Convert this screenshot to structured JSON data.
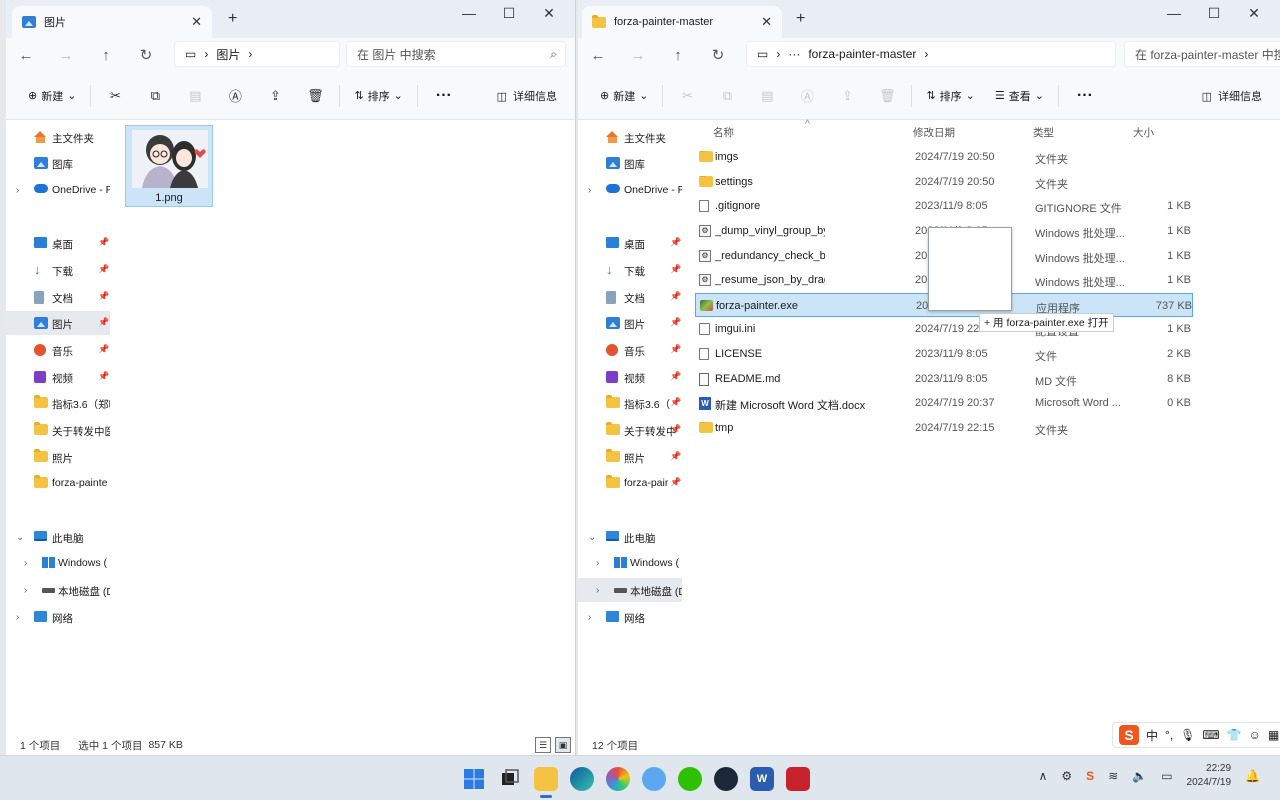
{
  "left_window": {
    "tab_title": "图片",
    "tab_close": "✕",
    "new_tab": "+",
    "win_btns": [
      "—",
      "☐",
      "✕"
    ],
    "address_folder": "图片",
    "address_sep": "›",
    "search_placeholder": "在 图片 中搜索",
    "toolbar": {
      "new_label": "新建",
      "sort_label": "排序",
      "details_label": "详细信息"
    },
    "sidebar": {
      "home": "主文件夹",
      "gallery": "图库",
      "onedrive": "OneDrive - P",
      "desktop": "桌面",
      "downloads": "下载",
      "documents": "文档",
      "pictures": "图片",
      "music": "音乐",
      "videos": "视频",
      "folder1": "指标3.6（郑噼",
      "folder2": "关于转发中医",
      "folder3": "照片",
      "folder4": "forza-painte",
      "this_pc": "此电脑",
      "windows_drive": "Windows (",
      "local_disk": "本地磁盘 (D",
      "network": "网络"
    },
    "files": [
      {
        "name": "1.png"
      }
    ],
    "status": {
      "count": "1 个项目",
      "selected": "选中 1 个项目",
      "size": "857 KB"
    }
  },
  "right_window": {
    "tab_title": "forza-painter-master",
    "tab_close": "✕",
    "new_tab": "+",
    "win_btns": [
      "—",
      "☐",
      "✕"
    ],
    "address_more": "···",
    "address_folder": "forza-painter-master",
    "address_sep": "›",
    "search_placeholder": "在 forza-painter-master 中搜",
    "toolbar": {
      "new_label": "新建",
      "sort_label": "排序",
      "view_label": "查看",
      "details_label": "详细信息"
    },
    "sidebar": {
      "home": "主文件夹",
      "gallery": "图库",
      "onedrive": "OneDrive - P",
      "desktop": "桌面",
      "downloads": "下载",
      "documents": "文档",
      "pictures": "图片",
      "music": "音乐",
      "videos": "视频",
      "folder1": "指标3.6（",
      "folder2": "关于转发中",
      "folder3": "照片",
      "folder4": "forza-pair",
      "this_pc": "此电脑",
      "windows_drive": "Windows (",
      "local_disk": "本地磁盘 (D",
      "network": "网络"
    },
    "columns": {
      "name": "名称",
      "modified": "修改日期",
      "type": "类型",
      "size": "大小"
    },
    "files": [
      {
        "name": "imgs",
        "date": "2024/7/19 20:50",
        "type": "文件夹",
        "size": ""
      },
      {
        "name": "settings",
        "date": "2024/7/19 20:50",
        "type": "文件夹",
        "size": ""
      },
      {
        "name": ".gitignore",
        "date": "2023/11/9 8:05",
        "type": "GITIGNORE 文件",
        "size": "1 KB"
      },
      {
        "name": "_dump_vinyl_group_by",
        "date": "2023/11/9 8:05",
        "type": "Windows 批处理...",
        "size": "1 KB"
      },
      {
        "name": "_redundancy_check_by",
        "date": "2023/11/9 8:05",
        "type": "Windows 批处理...",
        "size": "1 KB"
      },
      {
        "name": "_resume_json_by_drag",
        "date": "2023/11/9 8:05",
        "type": "Windows 批处理...",
        "size": "1 KB"
      },
      {
        "name": "forza-painter.exe",
        "date": "2023/11/9 8:05",
        "type": "应用程序",
        "size": "737 KB"
      },
      {
        "name": "imgui.ini",
        "date": "2024/7/19 22:20",
        "type": "配置设置",
        "size": "1 KB"
      },
      {
        "name": "LICENSE",
        "date": "2023/11/9 8:05",
        "type": "文件",
        "size": "2 KB"
      },
      {
        "name": "README.md",
        "date": "2023/11/9 8:05",
        "type": "MD 文件",
        "size": "8 KB"
      },
      {
        "name": "新建 Microsoft Word 文档.docx",
        "date": "2024/7/19 20:37",
        "type": "Microsoft Word ...",
        "size": "0 KB"
      },
      {
        "name": "tmp",
        "date": "2024/7/19 22:15",
        "type": "文件夹",
        "size": ""
      }
    ],
    "drag_tip": "+ 用 forza-painter.exe 打开",
    "status": {
      "count": "12 个项目"
    }
  },
  "ime": {
    "logo": "S",
    "mode": "中",
    "punct": "°,"
  },
  "taskbar": {
    "time": "22:29",
    "date": "2024/7/19",
    "sogou": "S"
  }
}
